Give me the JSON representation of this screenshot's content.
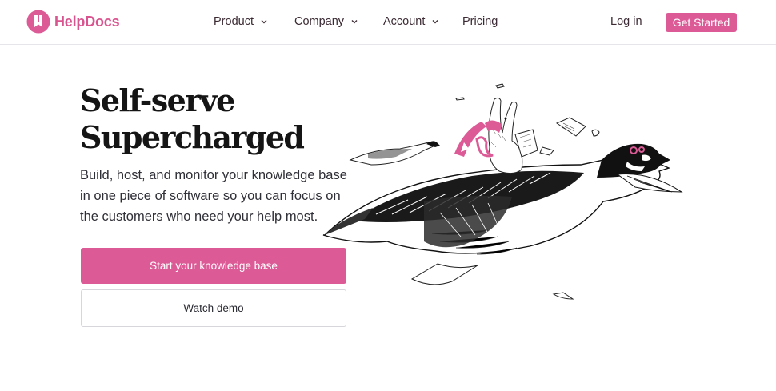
{
  "brand": {
    "name": "HelpDocs",
    "accent": "#dc5b97"
  },
  "nav": {
    "items": [
      {
        "label": "Product",
        "icon": "chevron-down-icon"
      },
      {
        "label": "Company",
        "icon": "chevron-down-icon"
      },
      {
        "label": "Account",
        "icon": "chevron-down-icon"
      },
      {
        "label": "Pricing"
      }
    ],
    "login": "Log in",
    "cta": "Get Started"
  },
  "hero": {
    "title_line1": "Self-serve",
    "title_line2": "Supercharged",
    "subtitle": "Build, host, and monitor your knowledge base in one piece of software so you can focus on the customers who need your help most.",
    "primary_button": "Start your knowledge base",
    "secondary_button": "Watch demo",
    "illustration": "goose-with-rabbit-illustration"
  }
}
